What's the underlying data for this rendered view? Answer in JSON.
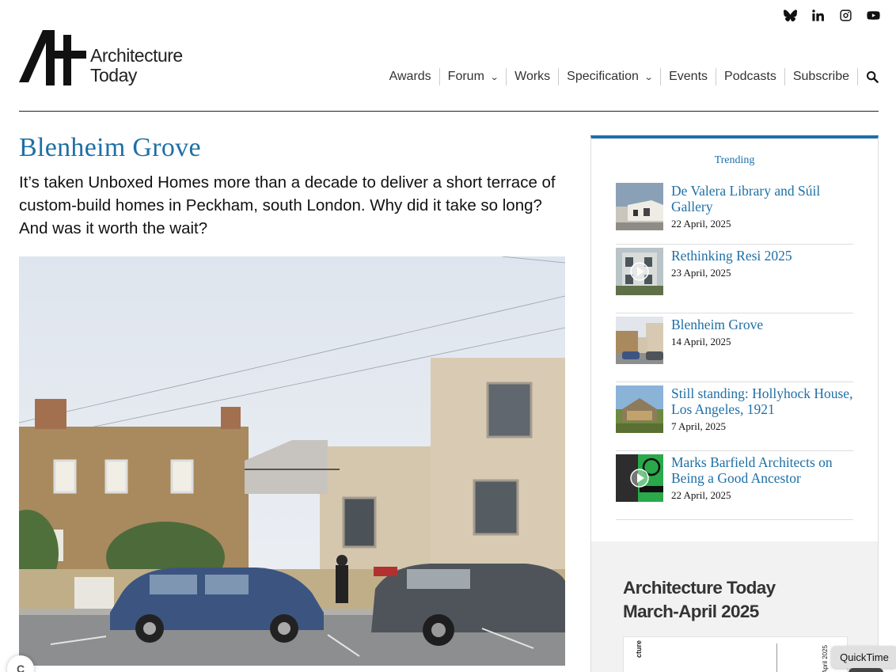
{
  "site": {
    "logo_line1": "Architecture",
    "logo_line2": "Today"
  },
  "social": [
    "bluesky-icon",
    "linkedin-icon",
    "instagram-icon",
    "youtube-icon"
  ],
  "nav": {
    "items": [
      {
        "label": "Awards",
        "dropdown": false
      },
      {
        "label": "Forum",
        "dropdown": true
      },
      {
        "label": "Works",
        "dropdown": false
      },
      {
        "label": "Specification",
        "dropdown": true
      },
      {
        "label": "Events",
        "dropdown": false
      },
      {
        "label": "Podcasts",
        "dropdown": false
      },
      {
        "label": "Subscribe",
        "dropdown": false
      }
    ]
  },
  "article": {
    "title": "Blenheim Grove",
    "standfirst": "It’s taken Unboxed Homes more than a decade to deliver a short terrace of custom-build homes in Peckham, south London. Why did it take so long? And was it worth the wait?"
  },
  "sidebar": {
    "label": "Trending",
    "items": [
      {
        "title": "De Valera Library and Súil Gallery",
        "date": "22 April, 2025",
        "video": false
      },
      {
        "title": "Rethinking Resi 2025",
        "date": "23 April, 2025",
        "video": true
      },
      {
        "title": "Blenheim Grove",
        "date": "14 April, 2025",
        "video": false
      },
      {
        "title": "Still standing: Hollyhock House, Los Angeles, 1921",
        "date": "7 April, 2025",
        "video": false
      },
      {
        "title": "Marks Barfield Architects on Being a Good Ancestor",
        "date": "22 April, 2025",
        "video": true
      }
    ]
  },
  "magazine": {
    "title_line1": "Architecture Today",
    "title_line2": "March-April 2025",
    "spine": "cture",
    "cover_date": "April 2025"
  },
  "overlay": {
    "quicktime": "QuickTime",
    "cookie": "C"
  },
  "colors": {
    "accent": "#1e6fa6"
  }
}
